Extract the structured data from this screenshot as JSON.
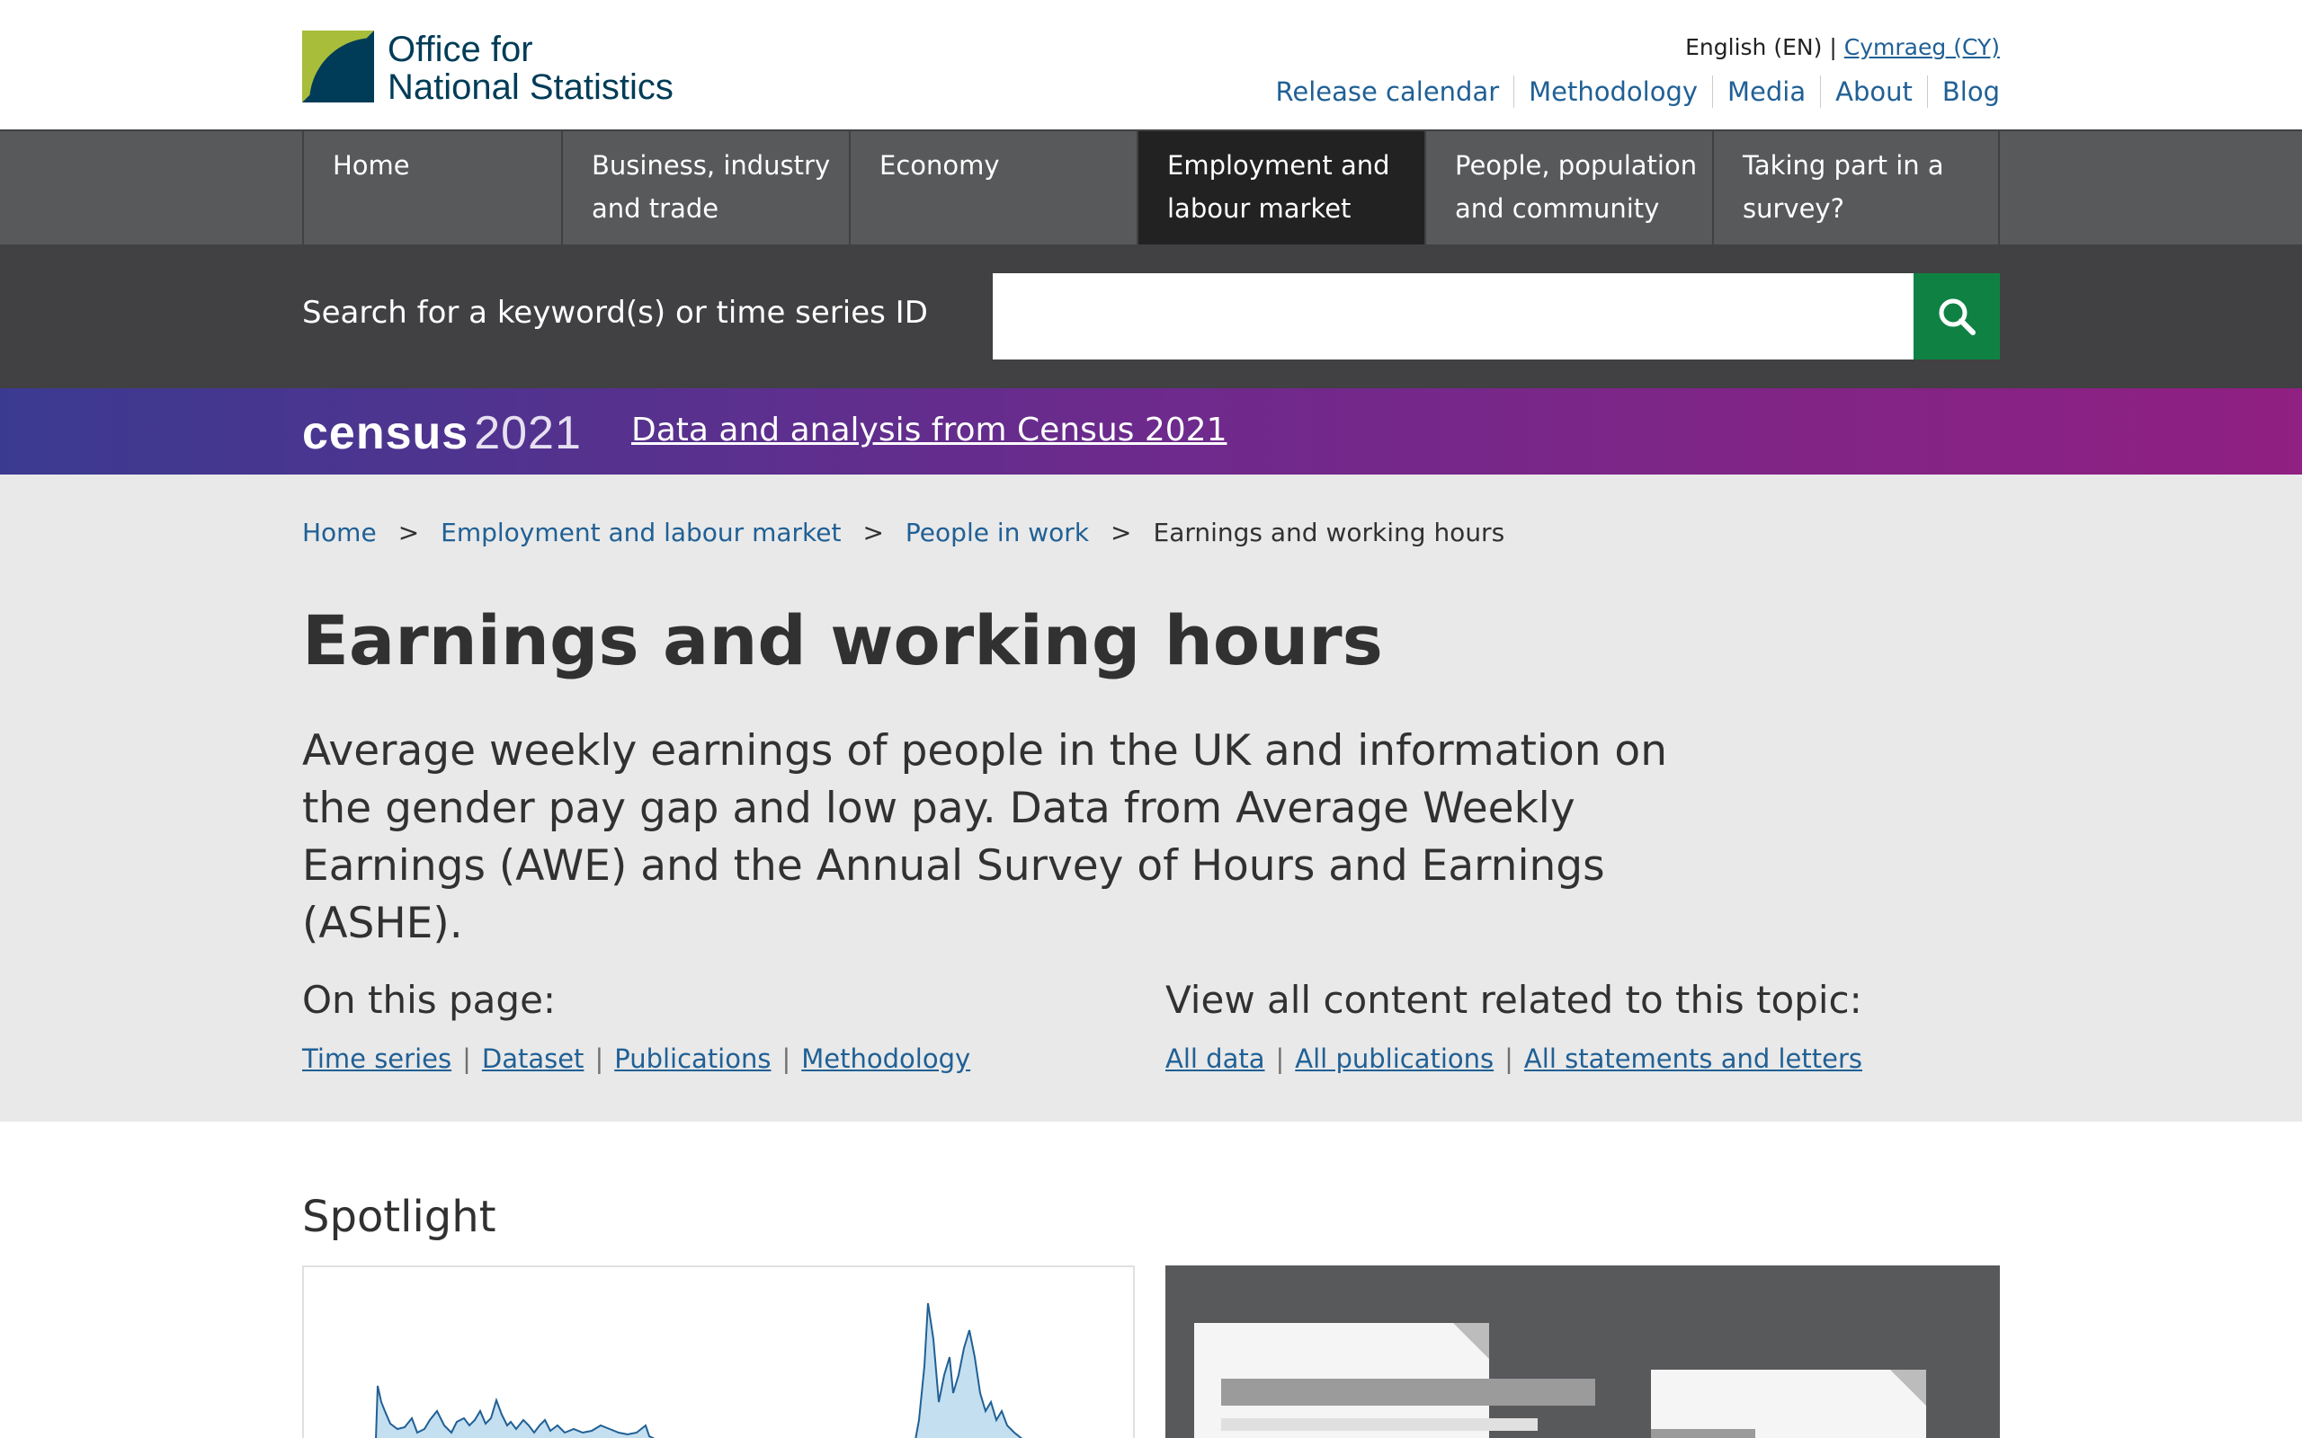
{
  "header": {
    "logo_line1": "Office for",
    "logo_line2": "National Statistics",
    "lang_en": "English (EN)",
    "lang_sep": "|",
    "lang_cy": "Cymraeg (CY)",
    "links": [
      "Release calendar",
      "Methodology",
      "Media",
      "About",
      "Blog"
    ]
  },
  "nav": {
    "items": [
      {
        "label": "Home"
      },
      {
        "label": "Business, industry and trade"
      },
      {
        "label": "Economy"
      },
      {
        "label": "Employment and labour market"
      },
      {
        "label": "People, population and community"
      },
      {
        "label": "Taking part in a survey?"
      }
    ]
  },
  "search": {
    "label": "Search for a keyword(s) or time series ID",
    "value": ""
  },
  "census": {
    "word": "census",
    "year": "2021",
    "link": "Data and analysis from Census 2021"
  },
  "breadcrumb": {
    "items": [
      "Home",
      "Employment and labour market",
      "People in work"
    ],
    "sep": ">",
    "current": "Earnings and working hours"
  },
  "page": {
    "title": "Earnings and working hours",
    "lede": "Average weekly earnings of people in the UK and information on the gender pay gap and low pay. Data from Average Weekly Earnings (AWE) and the Annual Survey of Hours and Earnings (ASHE)."
  },
  "on_this_page": {
    "heading": "On this page:",
    "links": [
      "Time series",
      "Dataset",
      "Publications",
      "Methodology"
    ]
  },
  "related": {
    "heading": "View all content related to this topic:",
    "links": [
      "All data",
      "All publications",
      "All statements and letters"
    ]
  },
  "spotlight": {
    "heading": "Spotlight"
  },
  "colors": {
    "link": "#206095",
    "nav_bg": "#58595b",
    "nav_active": "#222222",
    "search_bg": "#414042",
    "search_btn": "#0f8243",
    "hero_bg": "#e9e9e9"
  }
}
